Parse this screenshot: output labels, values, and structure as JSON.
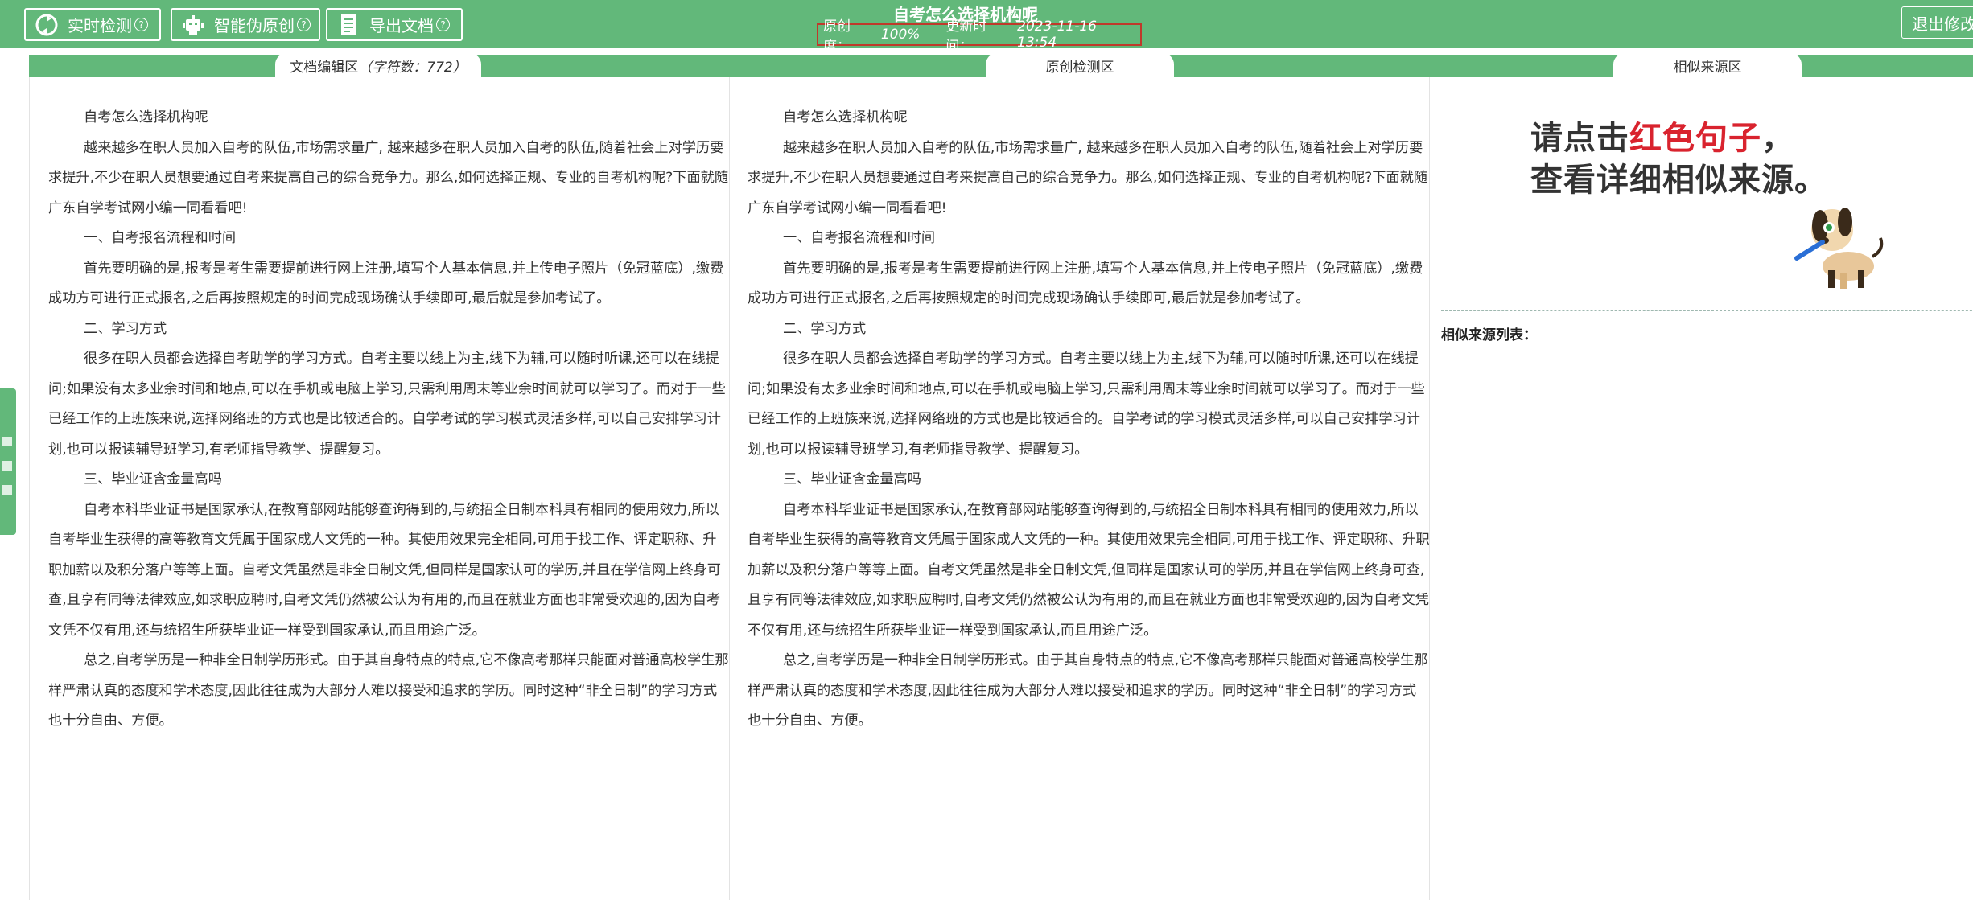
{
  "toolbar": {
    "realtime_label": "实时检测",
    "rewrite_label": "智能伪原创",
    "export_label": "导出文档",
    "help_glyph": "?"
  },
  "header": {
    "title": "自考怎么选择机构呢",
    "originality_label": "原创度：",
    "originality_value": "100%",
    "updated_label": "更新时间：",
    "updated_value": "2023-11-16 13:54",
    "logout_label": "退出修改"
  },
  "tabs": {
    "editor_label": "文档编辑区",
    "editor_count": "（字符数：772）",
    "detect_label": "原创检测区",
    "similar_label": "相似来源区"
  },
  "document": {
    "paragraphs": [
      "自考怎么选择机构呢",
      "越来越多在职人员加入自考的队伍,市场需求量广, 越来越多在职人员加入自考的队伍,随着社会上对学历要求提升,不少在职人员想要通过自考来提高自己的综合竞争力。那么,如何选择正规、专业的自考机构呢?下面就随广东自学考试网小编一同看看吧!",
      "一、自考报名流程和时间",
      "首先要明确的是,报考是考生需要提前进行网上注册,填写个人基本信息,并上传电子照片（免冠蓝底）,缴费成功方可进行正式报名,之后再按照规定的时间完成现场确认手续即可,最后就是参加考试了。",
      "二、学习方式",
      "很多在职人员都会选择自考助学的学习方式。自考主要以线上为主,线下为辅,可以随时听课,还可以在线提问;如果没有太多业余时间和地点,可以在手机或电脑上学习,只需利用周末等业余时间就可以学习了。而对于一些已经工作的上班族来说,选择网络班的方式也是比较适合的。自学考试的学习模式灵活多样,可以自己安排学习计划,也可以报读辅导班学习,有老师指导教学、提醒复习。",
      "三、毕业证含金量高吗",
      "自考本科毕业证书是国家承认,在教育部网站能够查询得到的,与统招全日制本科具有相同的使用效力,所以自考毕业生获得的高等教育文凭属于国家成人文凭的一种。其使用效果完全相同,可用于找工作、评定职称、升职加薪以及积分落户等等上面。自考文凭虽然是非全日制文凭,但同样是国家认可的学历,并且在学信网上终身可查,且享有同等法律效应,如求职应聘时,自考文凭仍然被公认为有用的,而且在就业方面也非常受欢迎的,因为自考文凭不仅有用,还与统招生所获毕业证一样受到国家承认,而且用途广泛。",
      "总之,自考学历是一种非全日制学历形式。由于其自身特点的特点,它不像高考那样只能面对普通高校学生那样严肃认真的态度和学术态度,因此往往成为大部分人难以接受和追求的学历。同时这种“非全日制”的学习方式也十分自由、方便。"
    ]
  },
  "detect": {
    "paragraphs": [
      "自考怎么选择机构呢",
      "越来越多在职人员加入自考的队伍,市场需求量广, 越来越多在职人员加入自考的队伍,随着社会上对学历要求提升,不少在职人员想要通过自考来提高自己的综合竞争力。那么,如何选择正规、专业的自考机构呢?下面就随广东自学考试网小编一同看看吧!",
      "一、自考报名流程和时间",
      "首先要明确的是,报考是考生需要提前进行网上注册,填写个人基本信息,并上传电子照片（免冠蓝底）,缴费成功方可进行正式报名,之后再按照规定的时间完成现场确认手续即可,最后就是参加考试了。",
      "二、学习方式",
      "很多在职人员都会选择自考助学的学习方式。自考主要以线上为主,线下为辅,可以随时听课,还可以在线提问;如果没有太多业余时间和地点,可以在手机或电脑上学习,只需利用周末等业余时间就可以学习了。而对于一些已经工作的上班族来说,选择网络班的方式也是比较适合的。自学考试的学习模式灵活多样,可以自己安排学习计划,也可以报读辅导班学习,有老师指导教学、提醒复习。",
      "三、毕业证含金量高吗",
      "自考本科毕业证书是国家承认,在教育部网站能够查询得到的,与统招全日制本科具有相同的使用效力,所以自考毕业生获得的高等教育文凭属于国家成人文凭的一种。其使用效果完全相同,可用于找工作、评定职称、升职加薪以及积分落户等等上面。自考文凭虽然是非全日制文凭,但同样是国家认可的学历,并且在学信网上终身可查,且享有同等法律效应,如求职应聘时,自考文凭仍然被公认为有用的,而且在就业方面也非常受欢迎的,因为自考文凭不仅有用,还与统招生所获毕业证一样受到国家承认,而且用途广泛。",
      "总之,自考学历是一种非全日制学历形式。由于其自身特点的特点,它不像高考那样只能面对普通高校学生那样严肃认真的态度和学术态度,因此往往成为大部分人难以接受和追求的学历。同时这种“非全日制”的学习方式也十分自由、方便。"
    ]
  },
  "similar": {
    "hint_prefix": "请点击",
    "hint_red": "红色句子",
    "hint_suffix": "，",
    "hint_line2": "查看详细相似来源。",
    "list_title": "相似来源列表：",
    "accent_color": "#d9232e"
  },
  "icons": {
    "realtime": "refresh-icon",
    "rewrite": "robot-icon",
    "export": "document-icon",
    "mascot": "dog-mascot-icon"
  },
  "theme": {
    "primary_green": "#62b87a",
    "status_border": "#c0392b"
  }
}
